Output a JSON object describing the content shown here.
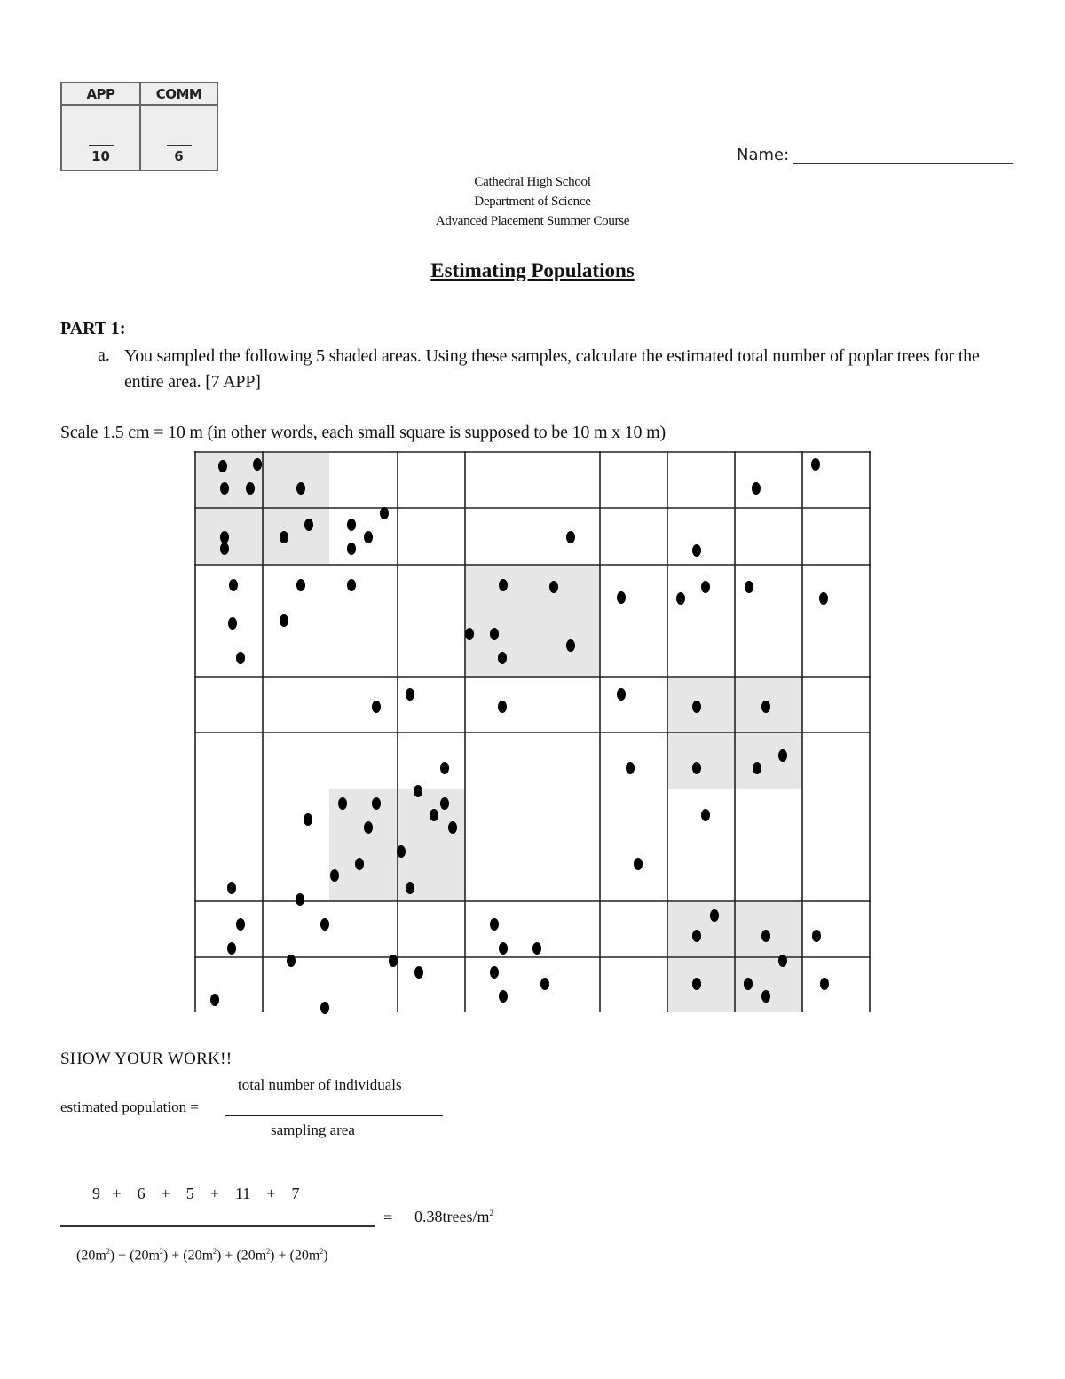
{
  "score_box": {
    "columns": [
      {
        "label": "APP",
        "max": "10"
      },
      {
        "label": "COMM",
        "max": "6"
      }
    ]
  },
  "name_label": "Name:",
  "header": {
    "school": "Cathedral High School",
    "department": "Department of Science",
    "course": "Advanced Placement Summer Course"
  },
  "title": "Estimating Populations",
  "part_label": "PART 1:",
  "question": {
    "label": "a.",
    "text": "You sampled the following 5 shaded areas. Using these samples, calculate the estimated total number of poplar trees for the entire area. [7 APP]"
  },
  "scale_text": "Scale 1.5 cm = 10 m (in other words, each small square is supposed to be 10 m x 10 m)",
  "colors": {
    "shade": "#e6e6e6",
    "grid_line": "#222222",
    "dot": "#000000"
  },
  "sample_counts": [
    9,
    6,
    5,
    11,
    7
  ],
  "show_work": "SHOW YOUR WORK!!",
  "formula": {
    "numerator": "total number of individuals",
    "lhs": "estimated population =",
    "denominator": "sampling area"
  },
  "calculation": {
    "numerator": "9   +    6    +    5    +    11    +    7",
    "equals": "=",
    "result": "0.38trees/m",
    "result_sup": "2",
    "denominator_terms": [
      "(20m",
      "2",
      ") + (20m",
      "2",
      ") + (20m",
      "2",
      ") + (20m",
      "2",
      ") + (20m",
      "2",
      ")"
    ]
  }
}
